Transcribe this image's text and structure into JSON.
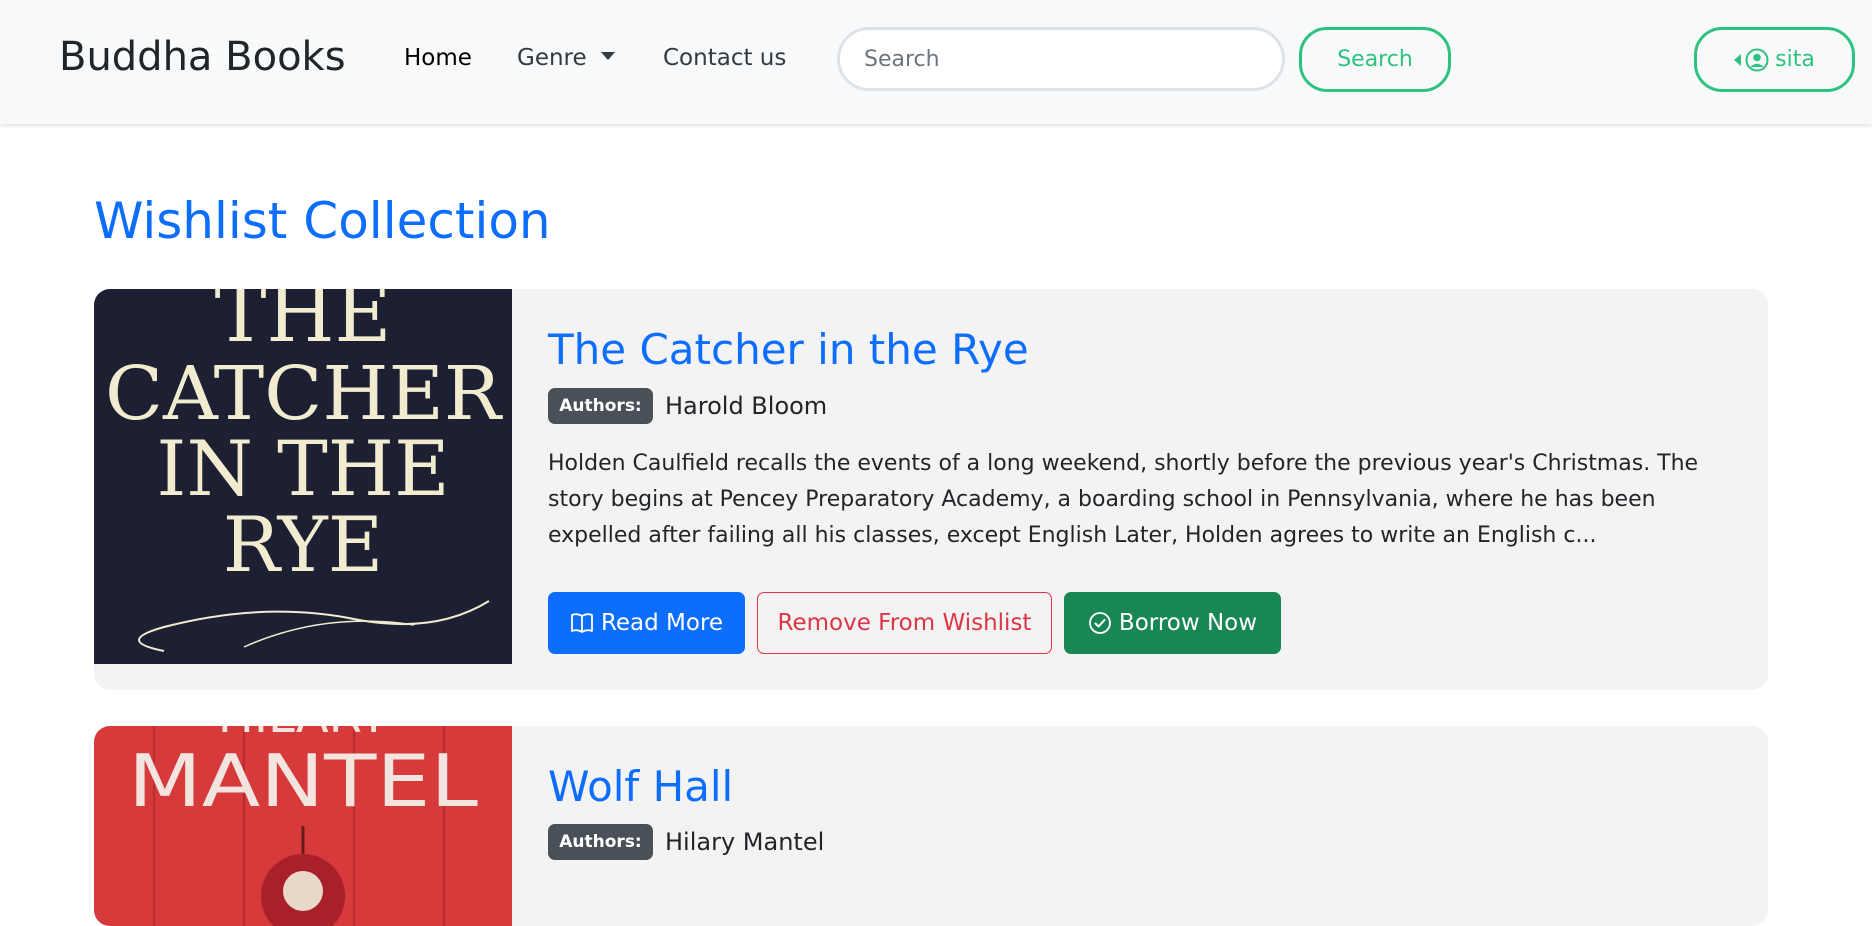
{
  "navbar": {
    "brand": "Buddha Books",
    "links": [
      {
        "label": "Home",
        "active": true
      },
      {
        "label": "Genre",
        "dropdown": true
      },
      {
        "label": "Contact us"
      }
    ],
    "search": {
      "placeholder": "Search",
      "value": "",
      "button_label": "Search"
    },
    "user": {
      "name": "sita"
    }
  },
  "page": {
    "title": "Wishlist Collection"
  },
  "books": [
    {
      "title": "The Catcher in the Rye",
      "author_badge": "Authors:",
      "author": "Harold Bloom",
      "description": "Holden Caulfield recalls the events of a long weekend, shortly before the previous year's Christmas. The story begins at Pencey Preparatory Academy, a boarding school in Pennsylvania, where he has been expelled after failing all his classes, except English Later, Holden agrees to write an English c...",
      "cover_text": [
        "THE",
        "CATCHER",
        "IN THE",
        "RYE"
      ],
      "actions": {
        "read_more": "Read More",
        "remove": "Remove From Wishlist",
        "borrow": "Borrow Now"
      }
    },
    {
      "title": "Wolf Hall",
      "author_badge": "Authors:",
      "author": "Hilary Mantel",
      "cover_text": [
        "HILARY",
        "MANTEL"
      ]
    }
  ],
  "colors": {
    "primary": "#0d6efd",
    "success_outline": "#2ec27e",
    "danger": "#dc3545",
    "success": "#198754",
    "badge": "#495057",
    "card_bg": "#f3f3f3",
    "cover1_bg": "#1d2032",
    "cover1_text": "#f1ecd0",
    "cover2_bg": "#d63a3a"
  }
}
